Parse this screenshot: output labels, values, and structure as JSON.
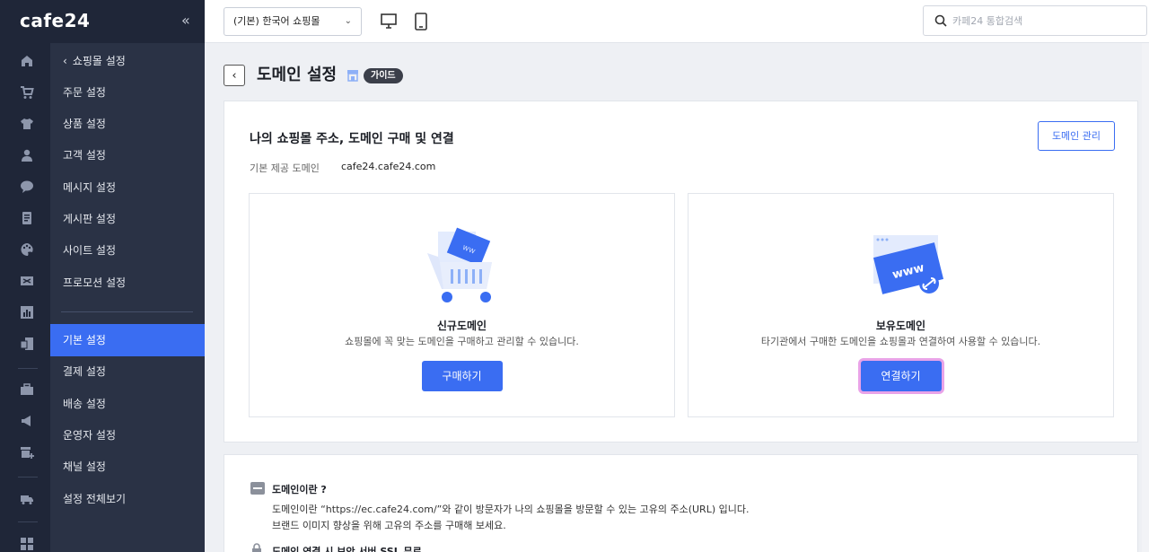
{
  "sidebar": {
    "logo": "cafe24",
    "collapse_glyph": "«",
    "back_label": "쇼핑몰 설정",
    "items_top": [
      "주문 설정",
      "상품 설정",
      "고객 설정",
      "메시지 설정",
      "게시판 설정",
      "사이트 설정",
      "프로모션 설정"
    ],
    "items_bottom": [
      "기본 설정",
      "결제 설정",
      "배송 설정",
      "운영자 설정",
      "채널 설정",
      "설정 전체보기"
    ],
    "active_item": "기본 설정",
    "rail_icons": [
      "home-icon",
      "cart-icon",
      "shirt-icon",
      "user-icon",
      "chat-icon",
      "board-icon",
      "palette-icon",
      "promo-icon",
      "chart-icon",
      "app-icon",
      "briefcase-icon",
      "megaphone-icon",
      "store-add-icon",
      "truck-icon",
      "grid-icon"
    ]
  },
  "topbar": {
    "shop_select": "(기본) 한국어 쇼핑몰",
    "search_placeholder": "카페24 통합검색"
  },
  "page": {
    "title": "도메인 설정",
    "guide_badge": "가이드"
  },
  "domain_card": {
    "title": "나의 쇼핑몰 주소, 도메인 구매 및 연결",
    "manage_button": "도메인 관리",
    "base_label": "기본 제공 도메인",
    "base_value": "cafe24.cafe24.com",
    "new_domain": {
      "title": "신규도메인",
      "desc": "쇼핑몰에 꼭 맞는 도메인을 구매하고 관리할 수 있습니다.",
      "button": "구매하기"
    },
    "own_domain": {
      "title": "보유도메인",
      "desc": "타기관에서 구매한 도메인을 쇼핑몰과 연결하여 사용할 수 있습니다.",
      "button": "연결하기"
    }
  },
  "info_card": {
    "title": "도메인이란 ?",
    "line1": "도메인이란 “https://ec.cafe24.com/”와 같이 방문자가 나의 쇼핑몰을 방문할 수 있는 고유의 주소(URL) 입니다.",
    "line2": "브랜드 이미지 향상을 위해 고유의 주소를 구매해 보세요.",
    "title2": "도메인 연결 시 보안 서버 SSL 무료"
  },
  "colors": {
    "accent": "#3a6df2",
    "sidebar": "#2a3245",
    "rail": "#1f2638",
    "highlight": "#e9a3e8"
  }
}
